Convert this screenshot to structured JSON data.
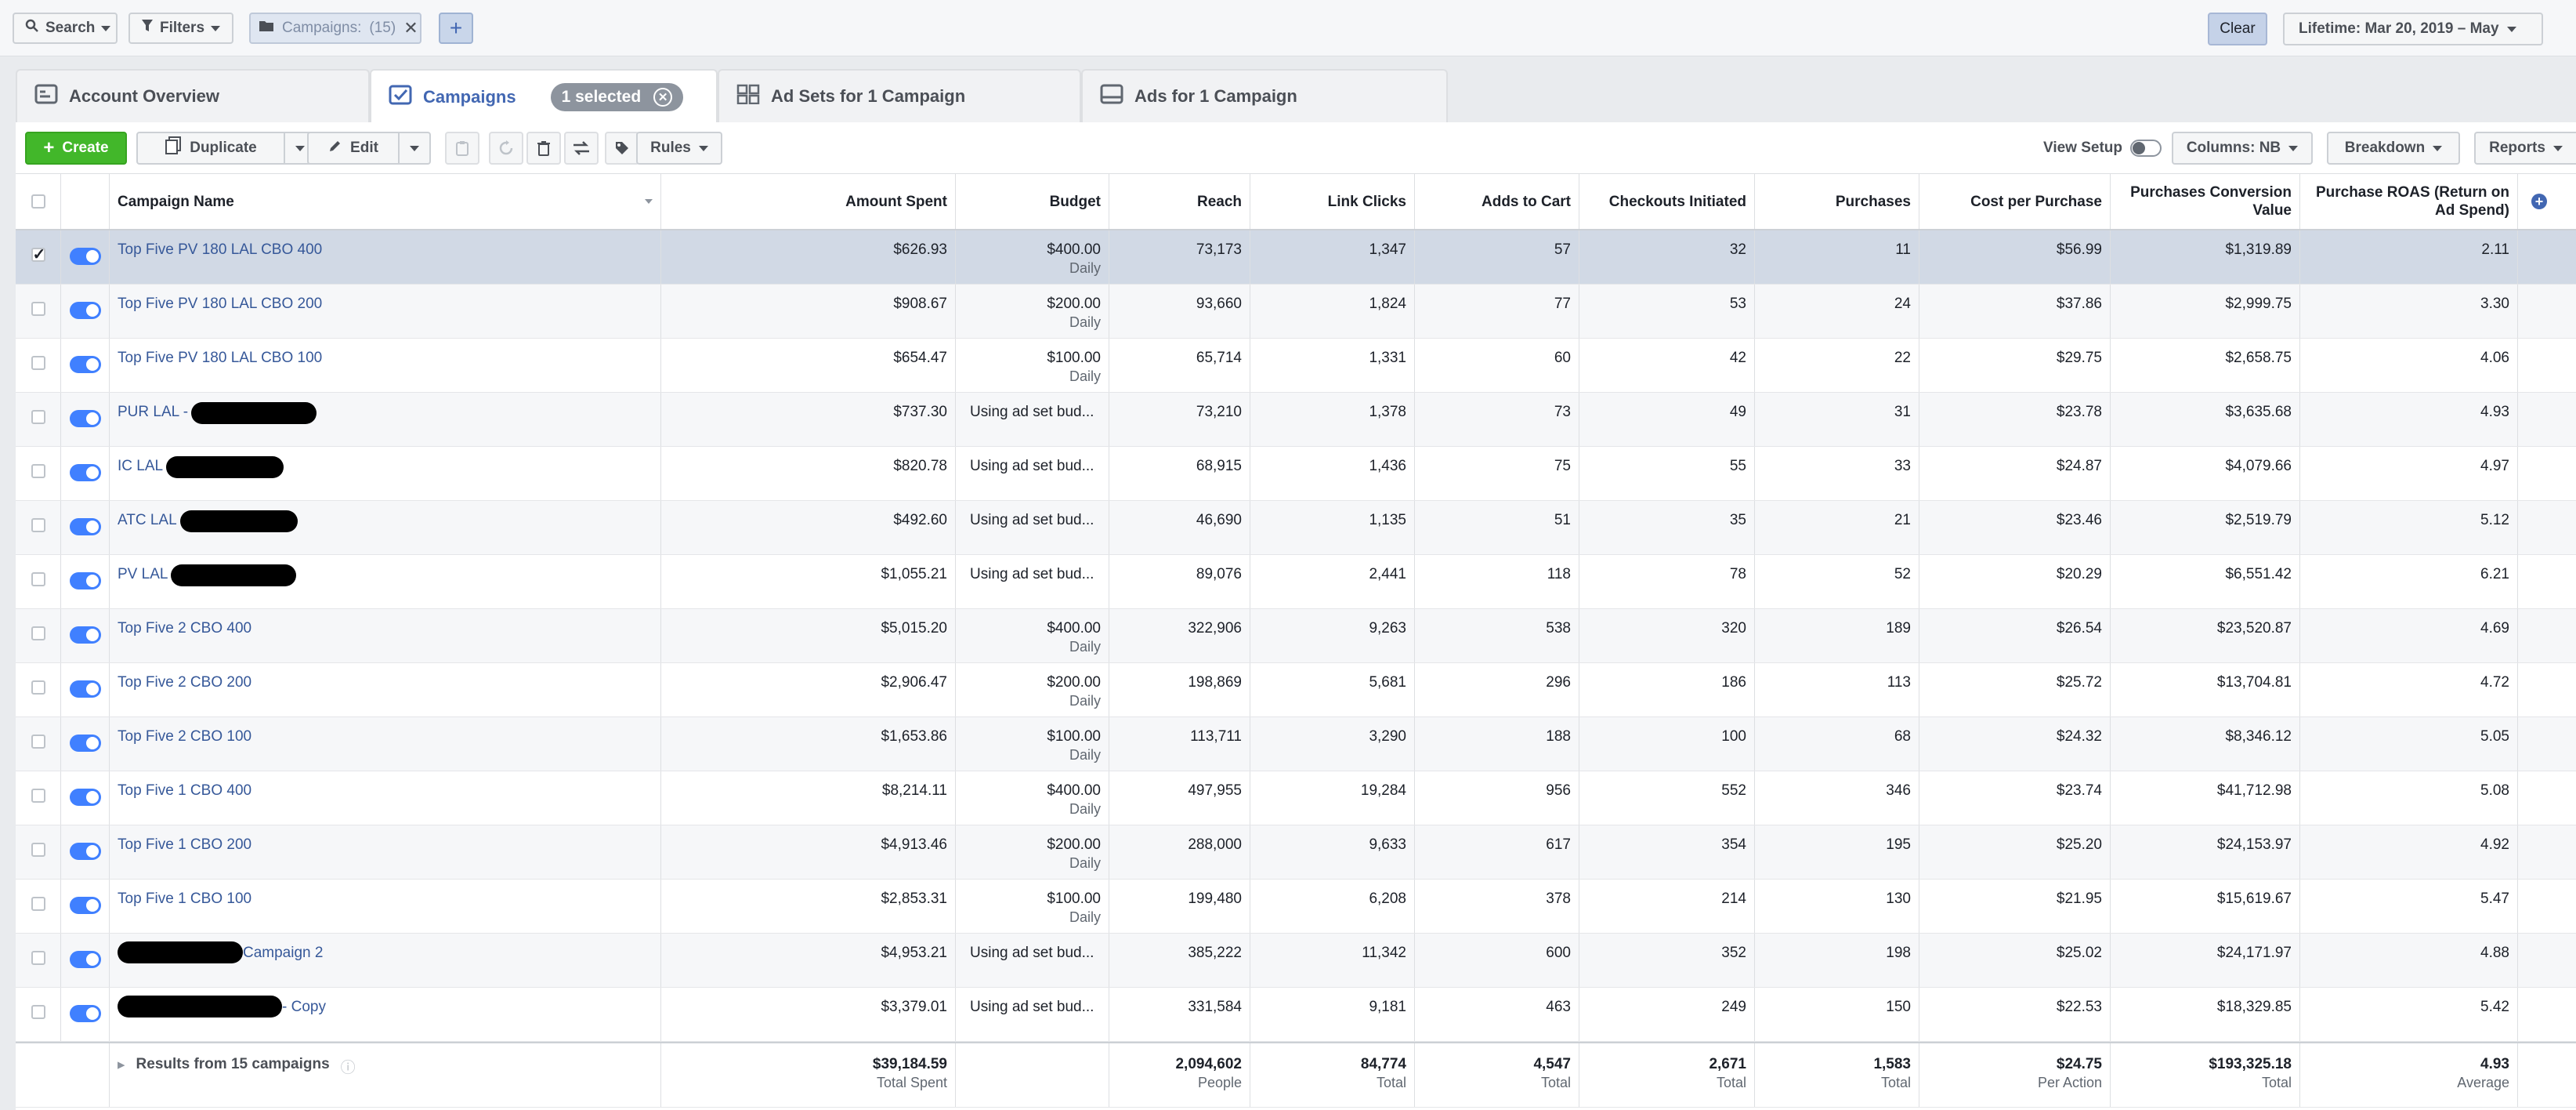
{
  "topbar": {
    "search_label": "Search",
    "filters_label": "Filters",
    "chip_label": "Campaigns:",
    "chip_count": "(15)",
    "clear_label": "Clear",
    "lifetime_label": "Lifetime: Mar 20, 2019 – May"
  },
  "tabs": [
    {
      "label": "Account Overview"
    },
    {
      "label": "Campaigns",
      "badge": "1 selected"
    },
    {
      "label": "Ad Sets for 1 Campaign"
    },
    {
      "label": "Ads for 1 Campaign"
    }
  ],
  "toolbar": {
    "create": "Create",
    "duplicate": "Duplicate",
    "edit": "Edit",
    "rules": "Rules",
    "view_setup": "View Setup",
    "columns": "Columns: NB",
    "breakdown": "Breakdown",
    "reports": "Reports"
  },
  "table": {
    "headers": {
      "name": "Campaign Name",
      "spent": "Amount Spent",
      "budget": "Budget",
      "reach": "Reach",
      "clicks": "Link Clicks",
      "atc": "Adds to Cart",
      "checkouts": "Checkouts Initiated",
      "purchases": "Purchases",
      "cpp": "Cost per Purchase",
      "pcv": "Purchases Conversion Value",
      "roas": "Purchase ROAS (Return on Ad Spend)"
    },
    "rows": [
      {
        "name": "Top Five PV 180 LAL CBO 400",
        "spent": "$626.93",
        "budget": "$400.00",
        "budget_sub": "Daily",
        "reach": "73,173",
        "clicks": "1,347",
        "atc": "57",
        "checkouts": "32",
        "purchases": "11",
        "cpp": "$56.99",
        "pcv": "$1,319.89",
        "roas": "2.11"
      },
      {
        "name": "Top Five PV 180 LAL CBO 200",
        "spent": "$908.67",
        "budget": "$200.00",
        "budget_sub": "Daily",
        "reach": "93,660",
        "clicks": "1,824",
        "atc": "77",
        "checkouts": "53",
        "purchases": "24",
        "cpp": "$37.86",
        "pcv": "$2,999.75",
        "roas": "3.30"
      },
      {
        "name": "Top Five PV 180 LAL CBO 100",
        "spent": "$654.47",
        "budget": "$100.00",
        "budget_sub": "Daily",
        "reach": "65,714",
        "clicks": "1,331",
        "atc": "60",
        "checkouts": "42",
        "purchases": "22",
        "cpp": "$29.75",
        "pcv": "$2,658.75",
        "roas": "4.06"
      },
      {
        "name": "PUR LAL -",
        "spent": "$737.30",
        "budget": "Using ad set bud...",
        "budget_sub": "",
        "reach": "73,210",
        "clicks": "1,378",
        "atc": "73",
        "checkouts": "49",
        "purchases": "31",
        "cpp": "$23.78",
        "pcv": "$3,635.68",
        "roas": "4.93"
      },
      {
        "name": "IC LAL",
        "spent": "$820.78",
        "budget": "Using ad set bud...",
        "budget_sub": "",
        "reach": "68,915",
        "clicks": "1,436",
        "atc": "75",
        "checkouts": "55",
        "purchases": "33",
        "cpp": "$24.87",
        "pcv": "$4,079.66",
        "roas": "4.97"
      },
      {
        "name": "ATC LAL",
        "spent": "$492.60",
        "budget": "Using ad set bud...",
        "budget_sub": "",
        "reach": "46,690",
        "clicks": "1,135",
        "atc": "51",
        "checkouts": "35",
        "purchases": "21",
        "cpp": "$23.46",
        "pcv": "$2,519.79",
        "roas": "5.12"
      },
      {
        "name": "PV LAL",
        "spent": "$1,055.21",
        "budget": "Using ad set bud...",
        "budget_sub": "",
        "reach": "89,076",
        "clicks": "2,441",
        "atc": "118",
        "checkouts": "78",
        "purchases": "52",
        "cpp": "$20.29",
        "pcv": "$6,551.42",
        "roas": "6.21"
      },
      {
        "name": "Top Five 2 CBO 400",
        "spent": "$5,015.20",
        "budget": "$400.00",
        "budget_sub": "Daily",
        "reach": "322,906",
        "clicks": "9,263",
        "atc": "538",
        "checkouts": "320",
        "purchases": "189",
        "cpp": "$26.54",
        "pcv": "$23,520.87",
        "roas": "4.69"
      },
      {
        "name": "Top Five 2 CBO 200",
        "spent": "$2,906.47",
        "budget": "$200.00",
        "budget_sub": "Daily",
        "reach": "198,869",
        "clicks": "5,681",
        "atc": "296",
        "checkouts": "186",
        "purchases": "113",
        "cpp": "$25.72",
        "pcv": "$13,704.81",
        "roas": "4.72"
      },
      {
        "name": "Top Five 2 CBO 100",
        "spent": "$1,653.86",
        "budget": "$100.00",
        "budget_sub": "Daily",
        "reach": "113,711",
        "clicks": "3,290",
        "atc": "188",
        "checkouts": "100",
        "purchases": "68",
        "cpp": "$24.32",
        "pcv": "$8,346.12",
        "roas": "5.05"
      },
      {
        "name": "Top Five 1 CBO 400",
        "spent": "$8,214.11",
        "budget": "$400.00",
        "budget_sub": "Daily",
        "reach": "497,955",
        "clicks": "19,284",
        "atc": "956",
        "checkouts": "552",
        "purchases": "346",
        "cpp": "$23.74",
        "pcv": "$41,712.98",
        "roas": "5.08"
      },
      {
        "name": "Top Five 1 CBO 200",
        "spent": "$4,913.46",
        "budget": "$200.00",
        "budget_sub": "Daily",
        "reach": "288,000",
        "clicks": "9,633",
        "atc": "617",
        "checkouts": "354",
        "purchases": "195",
        "cpp": "$25.20",
        "pcv": "$24,153.97",
        "roas": "4.92"
      },
      {
        "name": "Top Five 1 CBO 100",
        "spent": "$2,853.31",
        "budget": "$100.00",
        "budget_sub": "Daily",
        "reach": "199,480",
        "clicks": "6,208",
        "atc": "378",
        "checkouts": "214",
        "purchases": "130",
        "cpp": "$21.95",
        "pcv": "$15,619.67",
        "roas": "5.47"
      },
      {
        "name": "Campaign 2",
        "spent": "$4,953.21",
        "budget": "Using ad set bud...",
        "budget_sub": "",
        "reach": "385,222",
        "clicks": "11,342",
        "atc": "600",
        "checkouts": "352",
        "purchases": "198",
        "cpp": "$25.02",
        "pcv": "$24,171.97",
        "roas": "4.88"
      },
      {
        "name": "- Copy",
        "spent": "$3,379.01",
        "budget": "Using ad set bud...",
        "budget_sub": "",
        "reach": "331,584",
        "clicks": "9,181",
        "atc": "463",
        "checkouts": "249",
        "purchases": "150",
        "cpp": "$22.53",
        "pcv": "$18,329.85",
        "roas": "5.42"
      }
    ],
    "footer": {
      "label": "Results from 15 campaigns",
      "spent": "$39,184.59",
      "spent_sub": "Total Spent",
      "reach": "2,094,602",
      "reach_sub": "People",
      "clicks": "84,774",
      "clicks_sub": "Total",
      "atc": "4,547",
      "atc_sub": "Total",
      "checkouts": "2,671",
      "checkouts_sub": "Total",
      "purchases": "1,583",
      "purchases_sub": "Total",
      "cpp": "$24.75",
      "cpp_sub": "Per Action",
      "pcv": "$193,325.18",
      "pcv_sub": "Total",
      "roas": "4.93",
      "roas_sub": "Average"
    }
  },
  "colors": {
    "brand_blue": "#4267b2",
    "create_green": "#42b72a",
    "selected_row": "#d1d9e5",
    "toggle_on": "#4080ff"
  },
  "icons": [
    "search-icon",
    "filter-icon",
    "folder-icon",
    "close-icon",
    "plus-icon",
    "tab-overview-icon",
    "tab-campaigns-icon",
    "tab-adsets-icon",
    "tab-ads-icon",
    "duplicate-icon",
    "pencil-icon",
    "clipboard-icon",
    "refresh-icon",
    "trash-icon",
    "ab-test-icon",
    "tag-icon",
    "info-icon",
    "expand-icon"
  ]
}
